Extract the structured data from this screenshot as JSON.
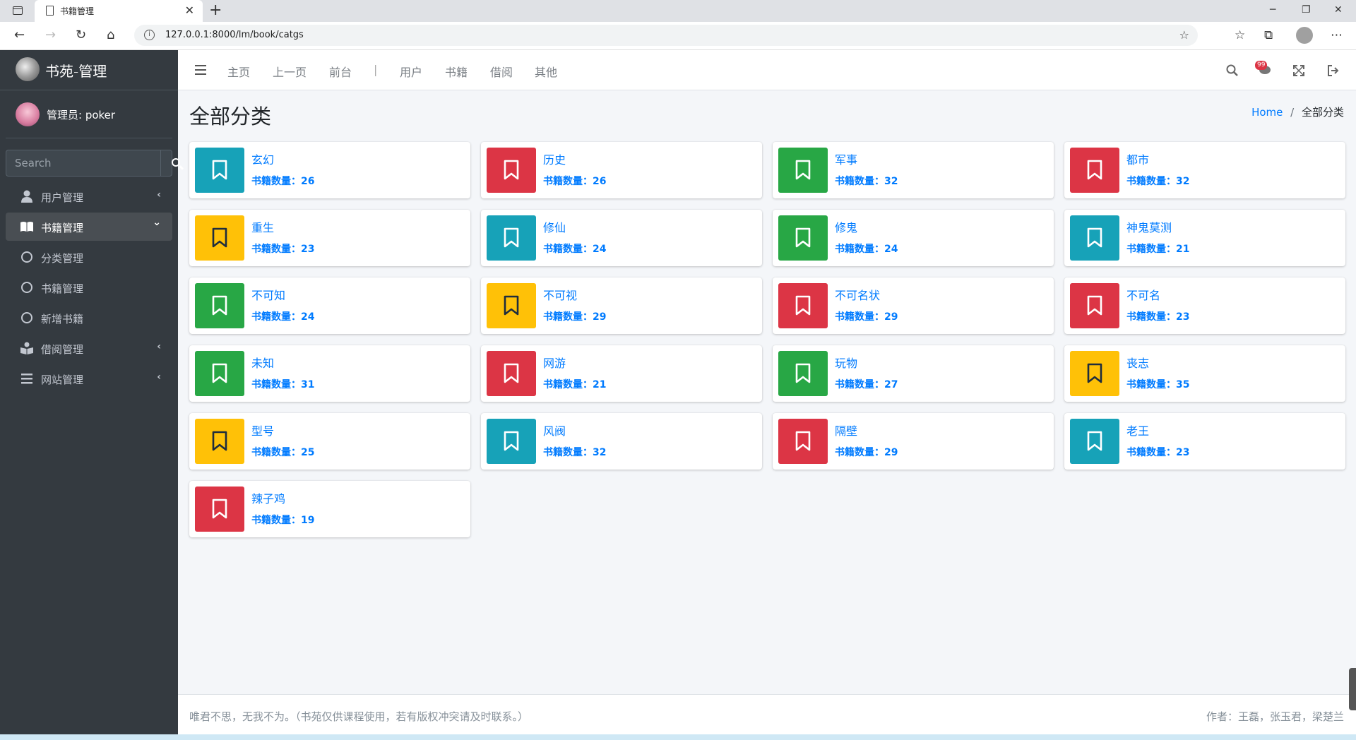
{
  "browser": {
    "tab_title": "书籍管理",
    "url": "127.0.0.1:8000/lm/book/catgs",
    "tab_close": "✕",
    "new_tab": "+",
    "minimize": "─",
    "restore": "❐",
    "close": "✕"
  },
  "sidebar": {
    "brand": "书苑-管理",
    "user": "管理员: poker",
    "search_placeholder": "Search",
    "menu": [
      {
        "label": "用户管理",
        "arrow": "‹"
      },
      {
        "label": "书籍管理",
        "arrow": "⌄"
      },
      {
        "label": "分类管理"
      },
      {
        "label": "书籍管理"
      },
      {
        "label": "新增书籍"
      },
      {
        "label": "借阅管理",
        "arrow": "‹"
      },
      {
        "label": "网站管理",
        "arrow": "‹"
      }
    ]
  },
  "navbar": {
    "links": [
      "主页",
      "上一页",
      "前台",
      "|",
      "用户",
      "书籍",
      "借阅",
      "其他"
    ],
    "badge": "99"
  },
  "page": {
    "title": "全部分类",
    "breadcrumb_home": "Home",
    "breadcrumb_sep": "/",
    "breadcrumb_current": "全部分类"
  },
  "colors": {
    "teal": "#17a2b8",
    "red": "#dc3545",
    "green": "#28a745",
    "yellow": "#ffc107"
  },
  "categories": [
    {
      "name": "玄幻",
      "count": "书籍数量：26",
      "color": "teal"
    },
    {
      "name": "历史",
      "count": "书籍数量：26",
      "color": "red"
    },
    {
      "name": "军事",
      "count": "书籍数量：32",
      "color": "green"
    },
    {
      "name": "都市",
      "count": "书籍数量：32",
      "color": "red"
    },
    {
      "name": "重生",
      "count": "书籍数量：23",
      "color": "yellow"
    },
    {
      "name": "修仙",
      "count": "书籍数量：24",
      "color": "teal"
    },
    {
      "name": "修鬼",
      "count": "书籍数量：24",
      "color": "green"
    },
    {
      "name": "神鬼莫测",
      "count": "书籍数量：21",
      "color": "teal"
    },
    {
      "name": "不可知",
      "count": "书籍数量：24",
      "color": "green"
    },
    {
      "name": "不可视",
      "count": "书籍数量：29",
      "color": "yellow"
    },
    {
      "name": "不可名状",
      "count": "书籍数量：29",
      "color": "red"
    },
    {
      "name": "不可名",
      "count": "书籍数量：23",
      "color": "red"
    },
    {
      "name": "未知",
      "count": "书籍数量：31",
      "color": "green"
    },
    {
      "name": "网游",
      "count": "书籍数量：21",
      "color": "red"
    },
    {
      "name": "玩物",
      "count": "书籍数量：27",
      "color": "green"
    },
    {
      "name": "丧志",
      "count": "书籍数量：35",
      "color": "yellow"
    },
    {
      "name": "型号",
      "count": "书籍数量：25",
      "color": "yellow"
    },
    {
      "name": "风阀",
      "count": "书籍数量：32",
      "color": "teal"
    },
    {
      "name": "隔壁",
      "count": "书籍数量：29",
      "color": "red"
    },
    {
      "name": "老王",
      "count": "书籍数量：23",
      "color": "teal"
    },
    {
      "name": "辣子鸡",
      "count": "书籍数量：19",
      "color": "red"
    }
  ],
  "footer": {
    "left": "唯君不思，无我不为。（书苑仅供课程使用，若有版权冲突请及时联系。）",
    "right": "作者：王磊，张玉君，梁楚兰"
  }
}
